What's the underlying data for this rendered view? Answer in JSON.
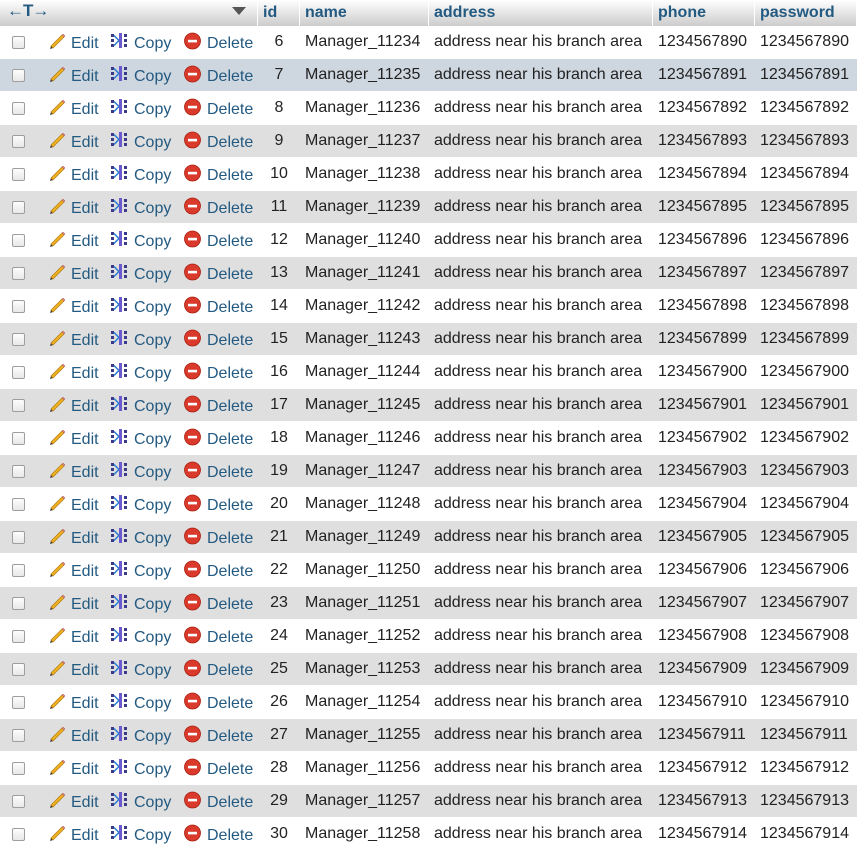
{
  "header": {
    "sort_arrows": "←T→",
    "columns": [
      "id",
      "name",
      "address",
      "phone",
      "password"
    ]
  },
  "actions": {
    "edit": "Edit",
    "copy": "Copy",
    "delete": "Delete"
  },
  "icons": {
    "edit": "pencil-icon",
    "copy": "copy-icon",
    "delete": "delete-icon",
    "menu": "dropdown-arrow-icon"
  },
  "colors": {
    "link": "#235a81",
    "row_even": "#dfdfdf",
    "row_marked": "#ced6df",
    "delete_red": "#d93a2b"
  },
  "rows": [
    {
      "id": "6",
      "name": "Manager_11234",
      "address": "address near his branch area",
      "phone": "1234567890",
      "password": "1234567890"
    },
    {
      "id": "7",
      "name": "Manager_11235",
      "address": "address near his branch area",
      "phone": "1234567891",
      "password": "1234567891",
      "marked": true
    },
    {
      "id": "8",
      "name": "Manager_11236",
      "address": "address near his branch area",
      "phone": "1234567892",
      "password": "1234567892"
    },
    {
      "id": "9",
      "name": "Manager_11237",
      "address": "address near his branch area",
      "phone": "1234567893",
      "password": "1234567893"
    },
    {
      "id": "10",
      "name": "Manager_11238",
      "address": "address near his branch area",
      "phone": "1234567894",
      "password": "1234567894"
    },
    {
      "id": "11",
      "name": "Manager_11239",
      "address": "address near his branch area",
      "phone": "1234567895",
      "password": "1234567895"
    },
    {
      "id": "12",
      "name": "Manager_11240",
      "address": "address near his branch area",
      "phone": "1234567896",
      "password": "1234567896"
    },
    {
      "id": "13",
      "name": "Manager_11241",
      "address": "address near his branch area",
      "phone": "1234567897",
      "password": "1234567897"
    },
    {
      "id": "14",
      "name": "Manager_11242",
      "address": "address near his branch area",
      "phone": "1234567898",
      "password": "1234567898"
    },
    {
      "id": "15",
      "name": "Manager_11243",
      "address": "address near his branch area",
      "phone": "1234567899",
      "password": "1234567899"
    },
    {
      "id": "16",
      "name": "Manager_11244",
      "address": "address near his branch area",
      "phone": "1234567900",
      "password": "1234567900"
    },
    {
      "id": "17",
      "name": "Manager_11245",
      "address": "address near his branch area",
      "phone": "1234567901",
      "password": "1234567901"
    },
    {
      "id": "18",
      "name": "Manager_11246",
      "address": "address near his branch area",
      "phone": "1234567902",
      "password": "1234567902"
    },
    {
      "id": "19",
      "name": "Manager_11247",
      "address": "address near his branch area",
      "phone": "1234567903",
      "password": "1234567903"
    },
    {
      "id": "20",
      "name": "Manager_11248",
      "address": "address near his branch area",
      "phone": "1234567904",
      "password": "1234567904"
    },
    {
      "id": "21",
      "name": "Manager_11249",
      "address": "address near his branch area",
      "phone": "1234567905",
      "password": "1234567905"
    },
    {
      "id": "22",
      "name": "Manager_11250",
      "address": "address near his branch area",
      "phone": "1234567906",
      "password": "1234567906"
    },
    {
      "id": "23",
      "name": "Manager_11251",
      "address": "address near his branch area",
      "phone": "1234567907",
      "password": "1234567907"
    },
    {
      "id": "24",
      "name": "Manager_11252",
      "address": "address near his branch area",
      "phone": "1234567908",
      "password": "1234567908"
    },
    {
      "id": "25",
      "name": "Manager_11253",
      "address": "address near his branch area",
      "phone": "1234567909",
      "password": "1234567909"
    },
    {
      "id": "26",
      "name": "Manager_11254",
      "address": "address near his branch area",
      "phone": "1234567910",
      "password": "1234567910"
    },
    {
      "id": "27",
      "name": "Manager_11255",
      "address": "address near his branch area",
      "phone": "1234567911",
      "password": "1234567911"
    },
    {
      "id": "28",
      "name": "Manager_11256",
      "address": "address near his branch area",
      "phone": "1234567912",
      "password": "1234567912"
    },
    {
      "id": "29",
      "name": "Manager_11257",
      "address": "address near his branch area",
      "phone": "1234567913",
      "password": "1234567913"
    },
    {
      "id": "30",
      "name": "Manager_11258",
      "address": "address near his branch area",
      "phone": "1234567914",
      "password": "1234567914"
    }
  ]
}
